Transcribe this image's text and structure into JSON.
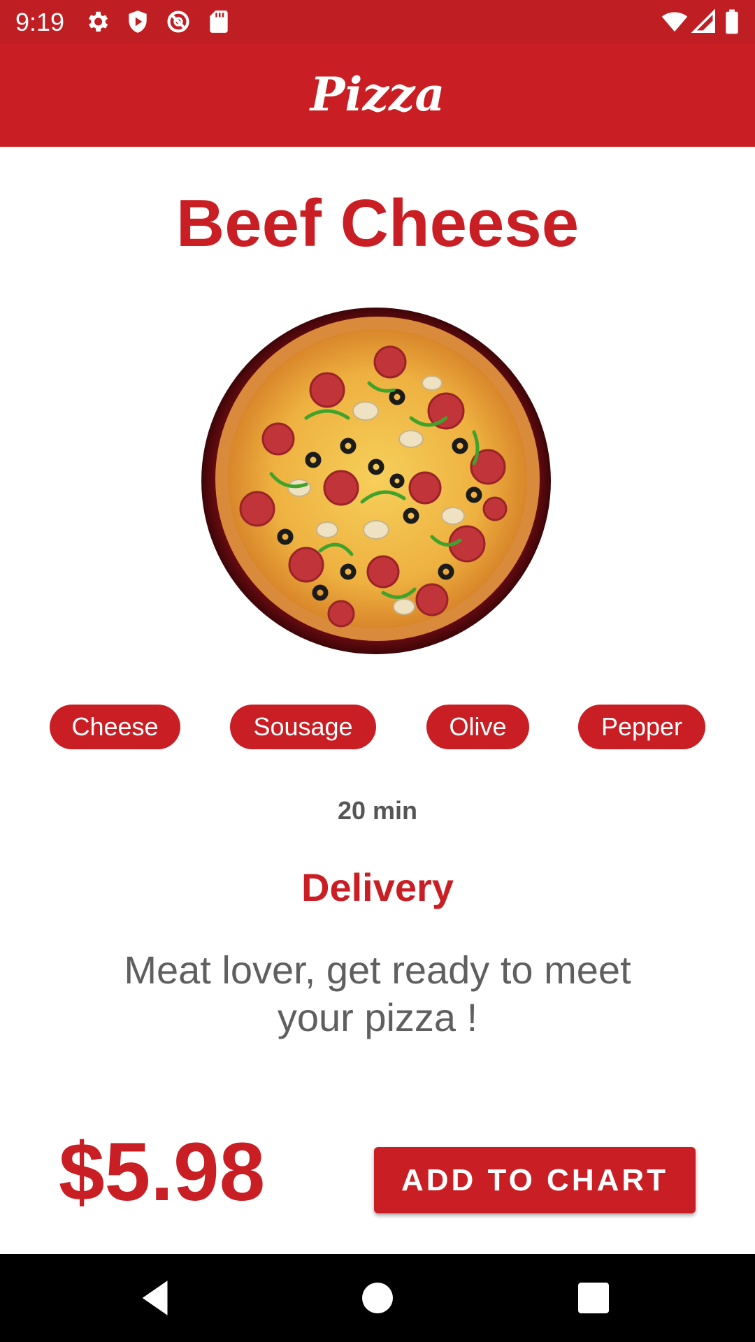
{
  "status_bar": {
    "time": "9:19",
    "icons_left": [
      "gear-icon",
      "shield-icon",
      "no-sync-icon",
      "sd-card-icon"
    ],
    "icons_right": [
      "wifi-icon",
      "signal-icon",
      "battery-icon"
    ],
    "color": "#bf1f23"
  },
  "app_bar": {
    "title": "Pizza",
    "color": "#c91f24"
  },
  "product": {
    "name": "Beef Cheese",
    "image": "pizza-image",
    "ingredients": [
      "Cheese",
      "Sousage",
      "Olive",
      "Pepper"
    ],
    "time": "20 min",
    "delivery_label": "Delivery",
    "description": "Meat lover, get ready to meet your pizza !",
    "price": "$5.98"
  },
  "actions": {
    "add_to_cart_label": "ADD TO CHART"
  },
  "nav_bar": {
    "buttons": [
      "back-icon",
      "home-icon",
      "recents-icon"
    ]
  },
  "colors": {
    "accent": "#c91f24",
    "text_secondary": "#5f5f5f"
  }
}
